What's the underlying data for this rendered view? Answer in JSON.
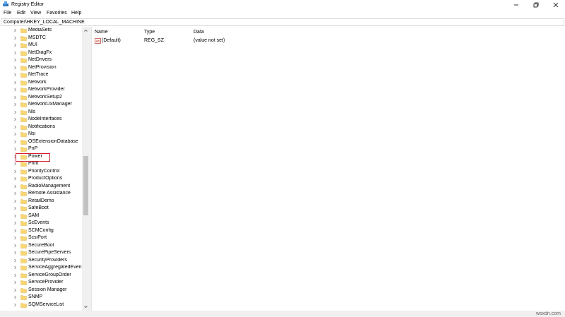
{
  "window": {
    "title": "Registry Editor",
    "controls": [
      "minimize",
      "maximize",
      "close"
    ]
  },
  "menu": [
    "File",
    "Edit",
    "View",
    "Favorites",
    "Help"
  ],
  "address": "Computer\\HKEY_LOCAL_MACHINE",
  "tree": {
    "items": [
      "MediaSets",
      "MSDTC",
      "MUI",
      "NetDiagFx",
      "NetDrivers",
      "NetProvision",
      "NetTrace",
      "Network",
      "NetworkProvider",
      "NetworkSetup2",
      "NetworkUxManager",
      "Nls",
      "NodeInterfaces",
      "Notifications",
      "Nsi",
      "OSExtensionDatabase",
      "PnP",
      "Power",
      "Print",
      "PriorityControl",
      "ProductOptions",
      "RadioManagement",
      "Remote Assistance",
      "RetailDemo",
      "SafeBoot",
      "SAM",
      "ScEvents",
      "SCMConfig",
      "ScsiPort",
      "SecureBoot",
      "SecurePipeServers",
      "SecurityProviders",
      "ServiceAggregatedEvents",
      "ServiceGroupOrder",
      "ServiceProvider",
      "Session Manager",
      "SNMP",
      "SQMServiceList"
    ],
    "highlighted": "Power"
  },
  "list": {
    "columns": [
      "Name",
      "Type",
      "Data"
    ],
    "rows": [
      {
        "name": "(Default)",
        "type": "REG_SZ",
        "data": "(value not set)"
      }
    ]
  },
  "status": {
    "watermark": "wsxdn.com"
  },
  "colors": {
    "highlight_border": "#d21f2b",
    "folder_fill": "#f8d775",
    "folder_edge": "#dcb44a"
  }
}
